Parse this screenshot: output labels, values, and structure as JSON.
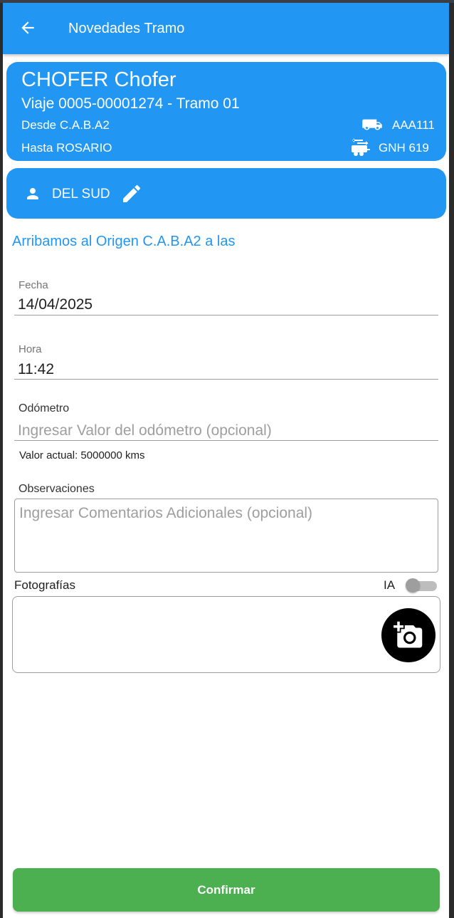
{
  "appbar": {
    "title": "Novedades Tramo",
    "back_icon": "arrow-back-icon"
  },
  "trip_card": {
    "driver": "CHOFER Chofer",
    "trip": "Viaje 0005-00001274 - Tramo 01",
    "from": "Desde C.A.B.A2",
    "to": "Hasta ROSARIO",
    "truck_icon": "truck-icon",
    "truck_plate": "AAA111",
    "trailer_icon": "trailer-icon",
    "trailer_plate": "GNH 619"
  },
  "company_card": {
    "person_icon": "person-icon",
    "name": "DEL SUD",
    "edit_icon": "edit-pencil-icon"
  },
  "section_title": "Arribamos al Origen C.A.B.A2 a las",
  "form": {
    "date": {
      "label": "Fecha",
      "value": "14/04/2025"
    },
    "time": {
      "label": "Hora",
      "value": "11:42"
    },
    "odometer": {
      "label": "Odómetro",
      "placeholder": "Ingresar Valor del odómetro (opcional)",
      "current": "Valor actual: 5000000 kms"
    },
    "observations": {
      "label": "Observaciones",
      "placeholder": "Ingresar Comentarios Adicionales (opcional)"
    },
    "photos": {
      "label": "Fotografías",
      "ia_label": "IA",
      "ia_enabled": false,
      "add_photo_icon": "add-a-photo-icon"
    }
  },
  "confirm_label": "Confirmar",
  "colors": {
    "primary": "#2196f3",
    "confirm": "#4caf50"
  }
}
